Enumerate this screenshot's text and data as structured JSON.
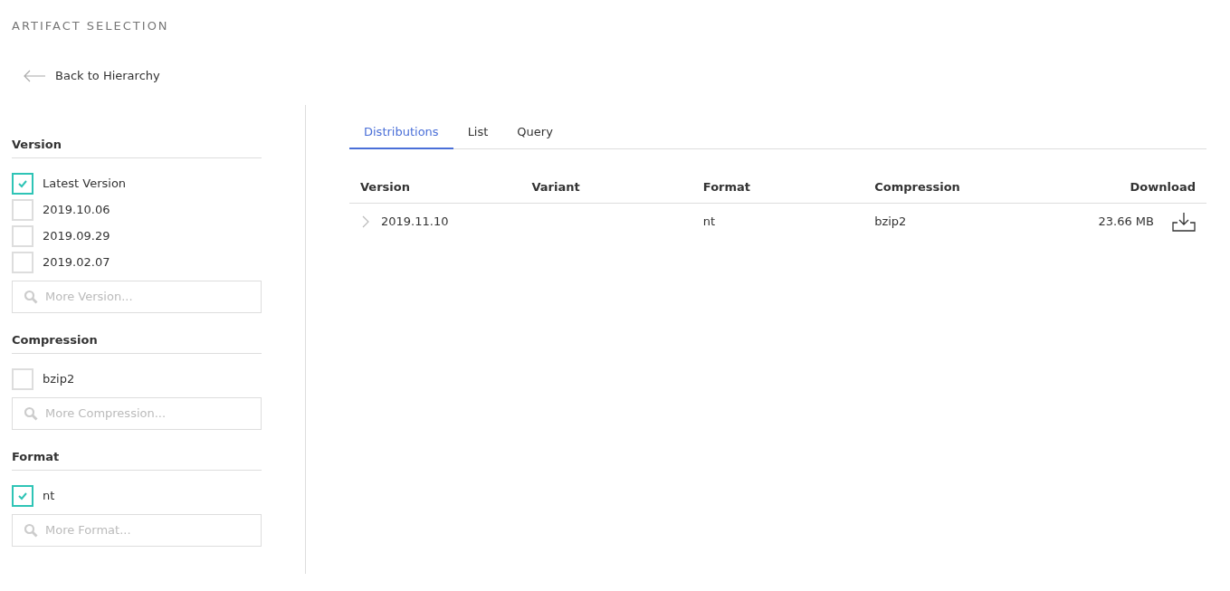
{
  "page_title": "ARTIFACT SELECTION",
  "back_link": "Back to Hierarchy",
  "filters": [
    {
      "title": "Version",
      "options": [
        {
          "label": "Latest Version",
          "checked": true
        },
        {
          "label": "2019.10.06",
          "checked": false
        },
        {
          "label": "2019.09.29",
          "checked": false
        },
        {
          "label": "2019.02.07",
          "checked": false
        }
      ],
      "search": {
        "placeholder": "More Version..."
      }
    },
    {
      "title": "Compression",
      "options": [
        {
          "label": "bzip2",
          "checked": false
        }
      ],
      "search": {
        "placeholder": "More Compression..."
      }
    },
    {
      "title": "Format",
      "options": [
        {
          "label": "nt",
          "checked": true
        }
      ],
      "search": {
        "placeholder": "More Format..."
      }
    }
  ],
  "tabs": [
    {
      "label": "Distributions",
      "selected": true
    },
    {
      "label": "List",
      "selected": false
    },
    {
      "label": "Query",
      "selected": false
    }
  ],
  "table": {
    "columns": [
      "Version",
      "Variant",
      "Format",
      "Compression",
      "Download"
    ],
    "rows": [
      {
        "version": "2019.11.10",
        "variant": "",
        "format": "nt",
        "compression": "bzip2",
        "size": "23.66 MB",
        "expanded": false
      }
    ]
  }
}
